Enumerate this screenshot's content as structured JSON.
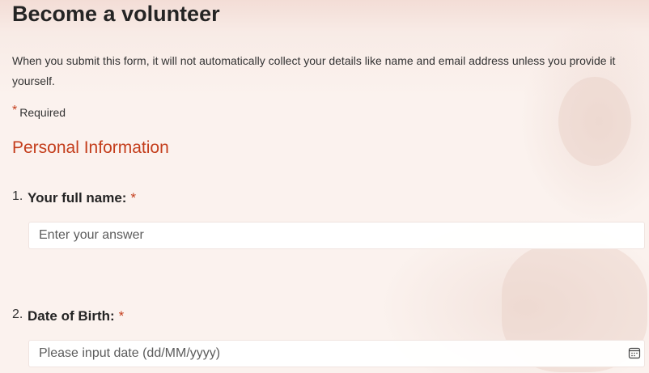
{
  "form": {
    "title": "Become a volunteer",
    "description": "When you submit this form, it will not automatically collect your details like name and email address unless you provide it yourself.",
    "required_note": "Required",
    "required_marker": "*",
    "section_title": "Personal Information"
  },
  "questions": [
    {
      "number": "1.",
      "label": "Your full name:",
      "required": "*",
      "placeholder": "Enter your answer"
    },
    {
      "number": "2.",
      "label": "Date of Birth:",
      "required": "*",
      "placeholder": "Please input date (dd/MM/yyyy)",
      "icon": "calendar-icon"
    }
  ],
  "colors": {
    "accent": "#c43e1c",
    "background": "#fbf0ec",
    "text": "#242424"
  }
}
